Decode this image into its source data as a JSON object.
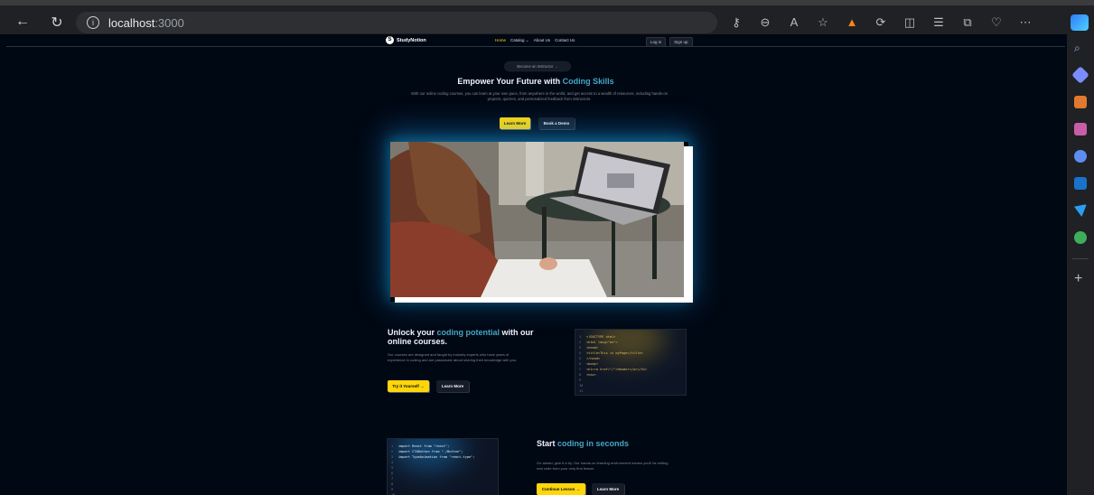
{
  "browser": {
    "url_host": "localhost",
    "url_port": ":3000"
  },
  "nav": {
    "brand": "StudyNotion",
    "logo_letter": "S",
    "links": [
      "Home",
      "Catalog",
      "About Us",
      "Contact Us"
    ],
    "login": "Log in",
    "signup": "Sign up"
  },
  "hero": {
    "pill": "Become an Instructor →",
    "title_plain": "Empower Your Future with ",
    "title_highlight": "Coding Skills",
    "subtitle": "With our online coding courses, you can learn at your own pace, from anywhere in the world, and get access to a wealth of resources, including hands-on projects, quizzes, and personalized feedback from instructors.",
    "btn_learn": "Learn More",
    "btn_demo": "Book a Demo"
  },
  "section1": {
    "title_a": "Unlock your ",
    "title_highlight": "coding potential",
    "title_b": " with our online courses.",
    "text": "Our courses are designed and taught by industry experts who have years of experience in coding and are passionate about sharing their knowledge with you.",
    "btn_try": "Try it Yourself →",
    "btn_learn": "Learn More",
    "code": [
      "<!DOCTYPE html>",
      "<html lang=\"en\">",
      "<head>",
      "<title>This is myPage</title>",
      "</head>",
      "<body>",
      "<h1><a href=\"/\">Header</a></h1>",
      "<nav>",
      "",
      "",
      ""
    ],
    "code_color": "#e7bc5b",
    "line_count": 11
  },
  "section2": {
    "title_a": "Start ",
    "title_highlight": "coding in seconds",
    "text": "Go ahead, give it a try. Our hands-on learning environment means you'll be writing real code from your very first lesson.",
    "btn_continue": "Continue Lesson →",
    "btn_learn": "Learn More",
    "code": [
      "import React from \"react\";",
      "import CTAButton from \"./Button\";",
      "import TypeAnimation from \"react-type\";",
      "",
      "",
      "",
      "",
      "",
      "",
      "",
      ""
    ],
    "code_color": "#e9eef5",
    "line_count": 11
  },
  "colors": {
    "accent_yellow": "#ffd60a",
    "highlight_blue": "#47a5c5",
    "bg": "#000814"
  }
}
